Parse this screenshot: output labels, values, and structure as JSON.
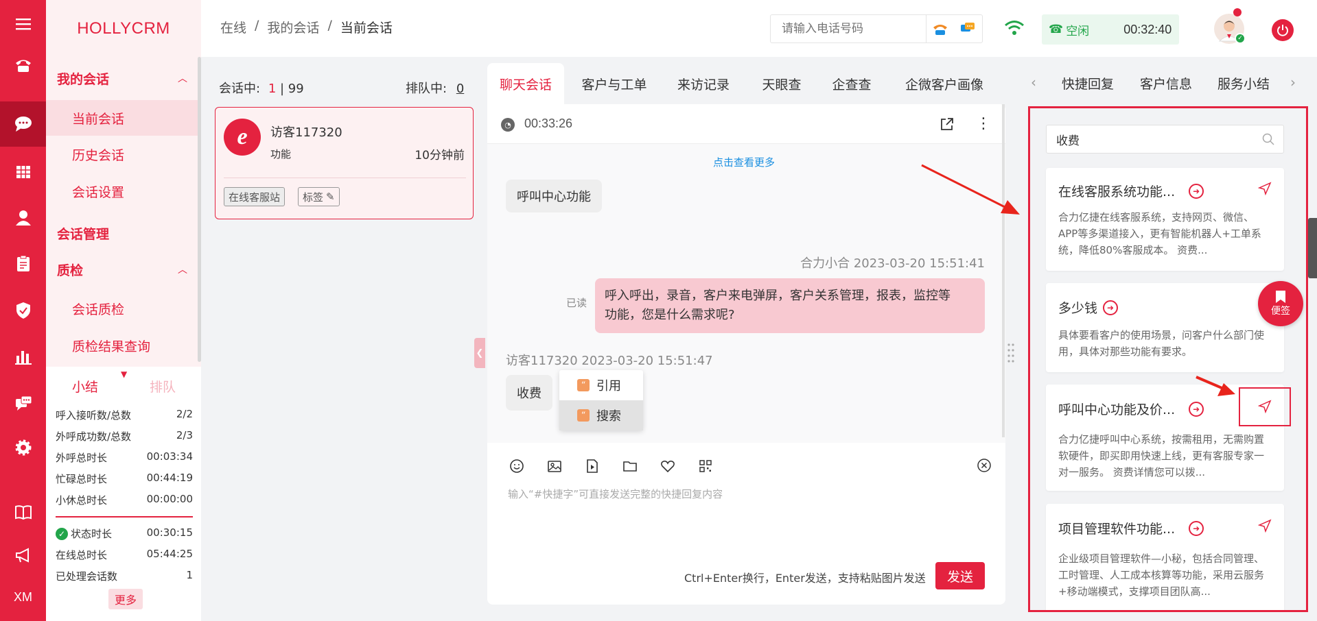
{
  "app": {
    "logo": "HOLLYCRM",
    "rail_bottom_label": "XM"
  },
  "nav": {
    "groups": [
      {
        "label": "我的会话",
        "items": [
          "当前会话",
          "历史会话",
          "会话设置"
        ]
      },
      {
        "label": "会话管理"
      },
      {
        "label": "质检",
        "items": [
          "会话质检",
          "质检结果查询"
        ]
      }
    ]
  },
  "summary": {
    "tabs": [
      "小结",
      "排队"
    ],
    "stats": [
      {
        "label": "呼入接听数/总数",
        "value": "2/2"
      },
      {
        "label": "外呼成功数/总数",
        "value": "2/3"
      },
      {
        "label": "外呼总时长",
        "value": "00:03:34"
      },
      {
        "label": "忙碌总时长",
        "value": "00:44:19"
      },
      {
        "label": "小休总时长",
        "value": "00:00:00"
      }
    ],
    "stats2": [
      {
        "label": "状态时长",
        "value": "00:30:15"
      },
      {
        "label": "在线总时长",
        "value": "05:44:25"
      },
      {
        "label": "已处理会话数",
        "value": "1"
      }
    ],
    "more": "更多"
  },
  "header": {
    "breadcrumb": [
      "在线",
      "我的会话",
      "当前会话"
    ],
    "phone_placeholder": "请输入电话号码",
    "status": "空闲",
    "timer": "00:32:40"
  },
  "sessions": {
    "active_label": "会话中:",
    "active_count": "1",
    "active_max": "99",
    "queue_label": "排队中:",
    "queue_count": "0",
    "card": {
      "name": "访客117320",
      "sub": "功能",
      "time": "10分钟前",
      "channel": "在线客服站",
      "tag": "标签"
    }
  },
  "chat": {
    "tabs": [
      "聊天会话",
      "客户与工单",
      "来访记录",
      "天眼查",
      "企查查",
      "企微客户画像"
    ],
    "timer": "00:33:26",
    "load_more": "点击查看更多",
    "messages": [
      {
        "text": "呼叫中心功能"
      },
      {
        "meta": "合力小合 2023-03-20 15:51:41",
        "read": "已读",
        "line1": "呼入呼出，录音，客户来电弹屏，客户关系管理，报表，监控等",
        "line2": "功能，您是什么需求呢?"
      },
      {
        "meta": "访客117320 2023-03-20 15:51:47",
        "text": "收费"
      }
    ],
    "context_menu": [
      "引用",
      "搜索"
    ],
    "input_placeholder": "输入“#快捷字”可直接发送完整的快捷回复内容",
    "send_hint": "Ctrl+Enter换行，Enter发送，支持粘贴图片发送",
    "send_label": "发送"
  },
  "right": {
    "tabs": [
      "快捷回复",
      "客户信息",
      "服务小结"
    ],
    "search_value": "收费",
    "cards": [
      {
        "title": "在线客服系统功能...",
        "desc": "合力亿捷在线客服系统，支持网页、微信、APP等多渠道接入，更有智能机器人+工单系统，降低80%客服成本。 资费..."
      },
      {
        "title": "多少钱",
        "desc": "具体要看客户的使用场景，问客户什么部门使用，具体对那些功能有要求。"
      },
      {
        "title": "呼叫中心功能及价...",
        "desc": "合力亿捷呼叫中心系统，按需租用，无需购置软硬件，即买即用快速上线，更有客服专家一对一服务。 资费详情您可以拨..."
      },
      {
        "title": "项目管理软件功能...",
        "desc": "企业级项目管理软件—小秘，包括合同管理、工时管理、人工成本核算等功能，采用云服务+移动端模式，支撑项目团队高..."
      }
    ],
    "sticky_label": "便签"
  },
  "colors": {
    "brand": "#e4223f",
    "success": "#22a54a",
    "link": "#1a8fe0"
  }
}
